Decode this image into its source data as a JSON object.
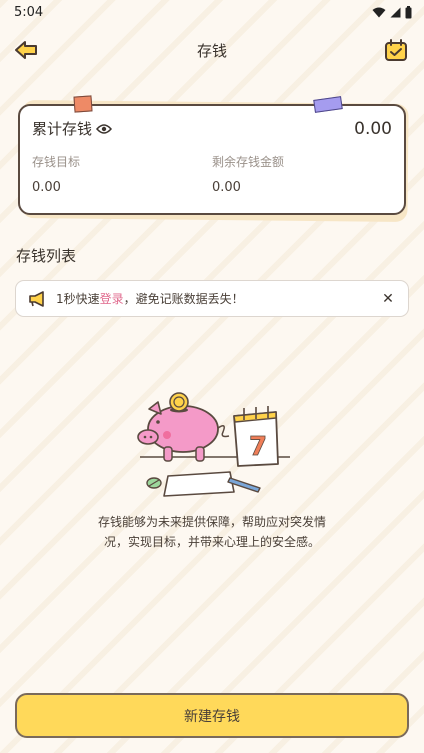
{
  "status_bar": {
    "time": "5:04"
  },
  "nav": {
    "title": "存钱"
  },
  "summary": {
    "total_label": "累计存钱",
    "total_value": "0.00",
    "goal_label": "存钱目标",
    "goal_value": "0.00",
    "remaining_label": "剩余存钱金额",
    "remaining_value": "0.00"
  },
  "section": {
    "title": "存钱列表"
  },
  "notice": {
    "prefix": "1秒快速",
    "link": "登录",
    "suffix": "，避免记账数据丢失！",
    "close": "✕"
  },
  "empty_state": {
    "calendar_day": "7",
    "text": "存钱能够为未来提供保障，帮助应对突发情况，实现目标，并带来心理上的安全感。"
  },
  "footer": {
    "new_button": "新建存钱"
  },
  "colors": {
    "accent": "#ffd95a",
    "link": "#e06a8e",
    "pig": "#f49ac8"
  }
}
